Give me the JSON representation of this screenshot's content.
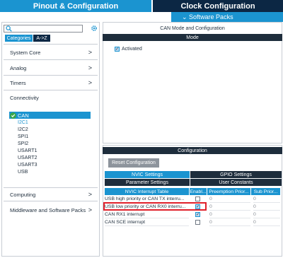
{
  "tabs": {
    "pinout": "Pinout & Configuration",
    "clock": "Clock Configuration",
    "software_packs": "⌄ Software Packs"
  },
  "left": {
    "search_value": "",
    "filter_tabs": {
      "categories": "Categories",
      "az": "A->Z"
    },
    "categories": [
      {
        "label": "System Core",
        "chevron": ">"
      },
      {
        "label": "Analog",
        "chevron": ">"
      },
      {
        "label": "Timers",
        "chevron": ">"
      },
      {
        "label": "Connectivity"
      },
      {
        "label": "Computing",
        "chevron": ">"
      },
      {
        "label": "Middleware and Software Packs",
        "chevron": ">"
      }
    ],
    "connectivity_items": [
      "CAN",
      "I2C1",
      "I2C2",
      "SPI1",
      "SPI2",
      "USART1",
      "USART2",
      "USART3",
      "USB"
    ]
  },
  "mode": {
    "title": "CAN Mode and Configuration",
    "bar": "Mode",
    "activated_label": "Activated",
    "activated_checked": true
  },
  "config": {
    "bar": "Configuration",
    "reset_button": "Reset Configuration",
    "tabs": {
      "nvic": "NVIC Settings",
      "gpio": "GPIO Settings",
      "param": "Parameter Settings",
      "user": "User Constants"
    },
    "columns": [
      "NVIC Interrupt Table",
      "Enabl...",
      "Preemption Prior...",
      "Sub Prior..."
    ],
    "rows": [
      {
        "name": "USB high priority or CAN TX interru...",
        "enabled": false,
        "preemption": "0",
        "sub": "0"
      },
      {
        "name": "USB low priority or CAN RX0 interru...",
        "enabled": true,
        "preemption": "0",
        "sub": "0"
      },
      {
        "name": "CAN RX1 interrupt",
        "enabled": true,
        "preemption": "0",
        "sub": "0"
      },
      {
        "name": "CAN SCE interrupt",
        "enabled": false,
        "preemption": "0",
        "sub": "0"
      }
    ]
  },
  "colors": {
    "accent": "#1b94d0",
    "dark": "#0c2744",
    "highlight": "#e0202a"
  }
}
